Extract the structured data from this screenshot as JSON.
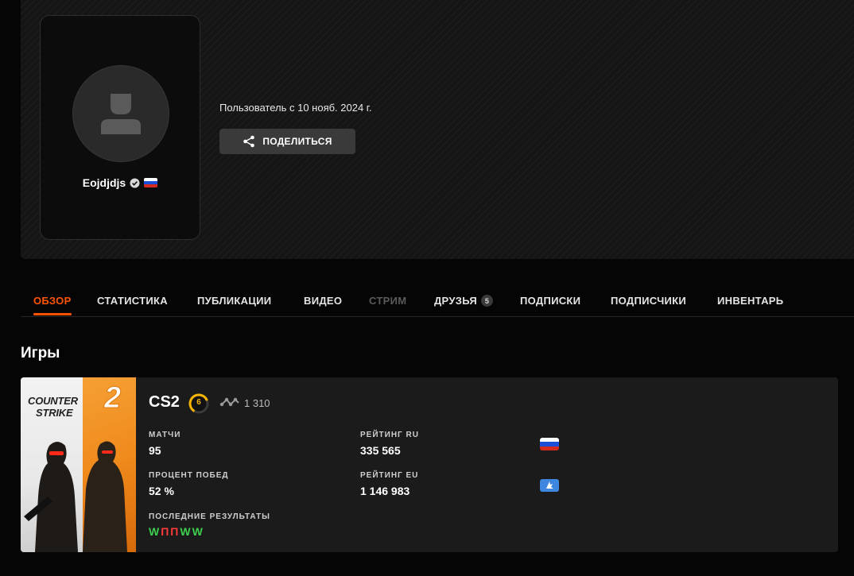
{
  "profile": {
    "username": "Eojdjdjs",
    "member_since": "Пользователь с 10 нояб. 2024 г.",
    "share_label": "ПОДЕЛИТЬСЯ"
  },
  "tabs": [
    {
      "label": "ОБЗОР",
      "state": "active"
    },
    {
      "label": "СТАТИСТИКА"
    },
    {
      "label": "ПУБЛИКАЦИИ"
    },
    {
      "label": "ВИДЕО"
    },
    {
      "label": "СТРИМ",
      "state": "disabled"
    },
    {
      "label": "ДРУЗЬЯ",
      "badge": "5"
    },
    {
      "label": "ПОДПИСКИ"
    },
    {
      "label": "ПОДПИСЧИКИ"
    },
    {
      "label": "ИНВЕНТАРЬ"
    }
  ],
  "games_section": {
    "title": "Игры",
    "game": {
      "cover_logo_line1": "COUNTER",
      "cover_logo_line2": "STRIKE",
      "cover_logo_number": "2",
      "name": "CS2",
      "level": "6",
      "elo": "1 310",
      "matches_label": "МАТЧИ",
      "matches_value": "95",
      "winrate_label": "ПРОЦЕНТ ПОБЕД",
      "winrate_value": "52 %",
      "recent_label": "ПОСЛЕДНИЕ РЕЗУЛЬТАТЫ",
      "recent_results": [
        "W",
        "П",
        "П",
        "W",
        "W"
      ],
      "rating_ru_label": "РЕЙТИНГ RU",
      "rating_ru_value": "335 565",
      "rating_eu_label": "РЕЙТИНГ EU",
      "rating_eu_value": "1 146 983"
    }
  },
  "colors": {
    "accent": "#ff5500",
    "win": "#3ccf4e",
    "loss": "#ff3b3b",
    "level": "#f5b400"
  }
}
